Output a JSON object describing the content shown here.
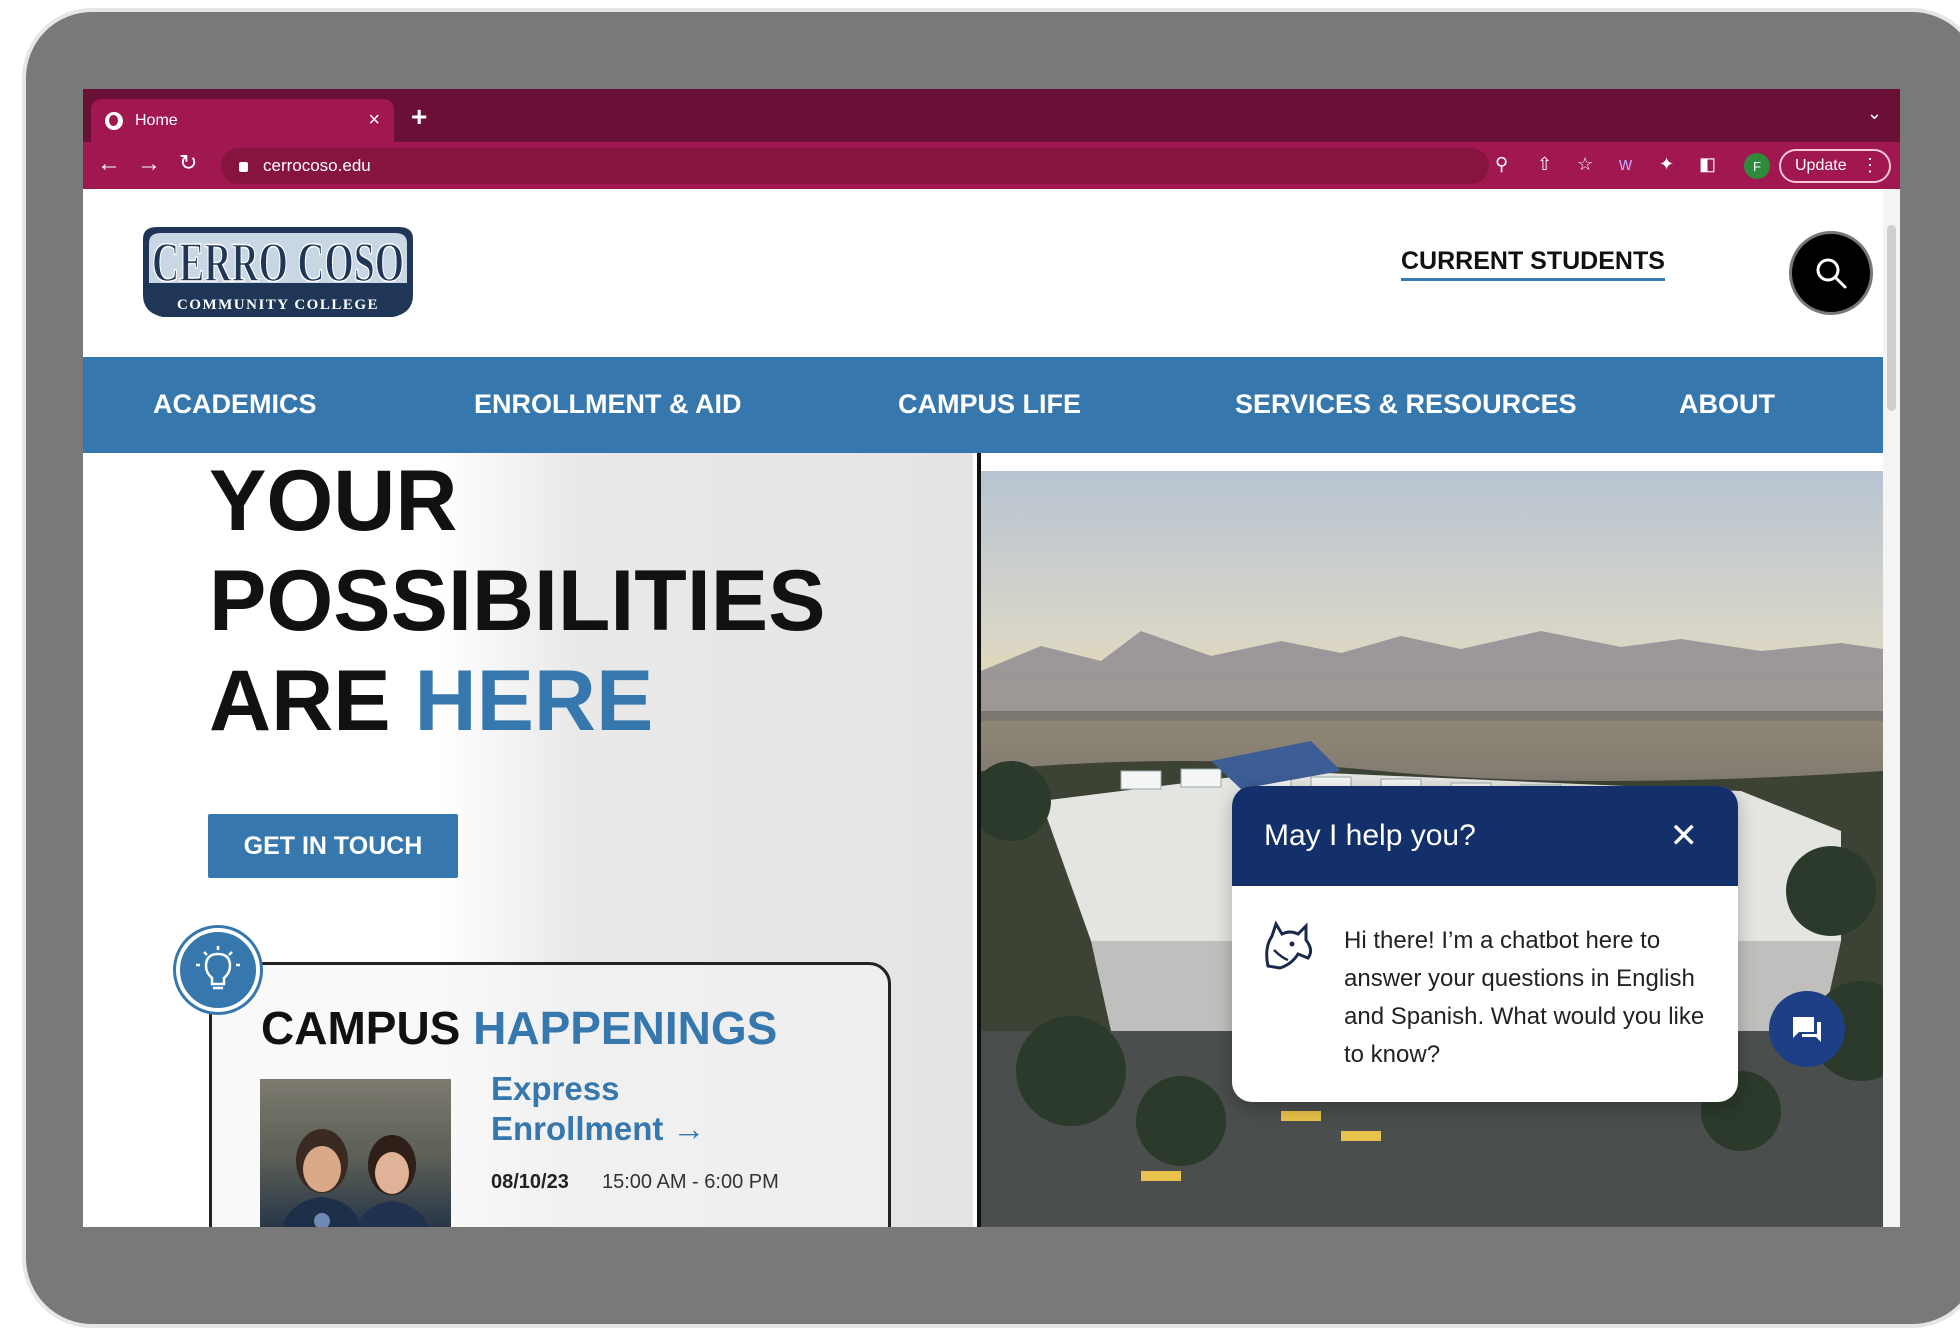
{
  "browser": {
    "tab_title": "Home",
    "tab_close": "×",
    "new_tab": "+",
    "url": "cerrocoso.edu",
    "profile_initial": "F",
    "update_label": "Update"
  },
  "header": {
    "logo_text": "CERRO COSO",
    "logo_subtext": "COMMUNITY COLLEGE",
    "current_students": "CURRENT STUDENTS"
  },
  "nav": {
    "items": [
      {
        "label": "ACADEMICS"
      },
      {
        "label": "ENROLLMENT & AID"
      },
      {
        "label": "CAMPUS LIFE"
      },
      {
        "label": "SERVICES & RESOURCES"
      },
      {
        "label": "ABOUT"
      }
    ]
  },
  "hero": {
    "line1": "YOUR",
    "line2": "POSSIBILITIES",
    "line3_plain": "ARE ",
    "line3_accent": "HERE",
    "cta_label": "GET IN TOUCH"
  },
  "happenings": {
    "title_plain": "CAMPUS ",
    "title_accent": "HAPPENINGS",
    "event": {
      "title_line1": "Express",
      "title_line2": "Enrollment",
      "date": "08/10/23",
      "time": "15:00 AM - 6:00 PM"
    }
  },
  "chat": {
    "title": "May I help you?",
    "message": "Hi there! I’m a chatbot here to answer your questions in English and Spanish. What would you like to know?"
  },
  "colors": {
    "brand_blue": "#3677ad",
    "chrome_maroon": "#a0184f",
    "chat_navy": "#14306b"
  }
}
